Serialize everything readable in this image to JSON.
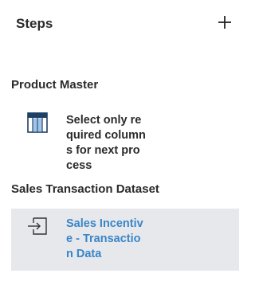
{
  "panel": {
    "title": "Steps",
    "add_icon": "plus-icon"
  },
  "groups": [
    {
      "label": "Product Master",
      "step": {
        "label": "Select only required columns for next process",
        "icon": "select-columns-icon",
        "selected": false
      }
    },
    {
      "label": "Sales Transaction Dataset",
      "step": {
        "label": "Sales Incentive - Transaction Data",
        "icon": "import-icon",
        "selected": true
      }
    }
  ],
  "colors": {
    "selected_bg": "#e6e8ec",
    "selected_text": "#3a86c8",
    "icon_blue": "#1e3f66"
  }
}
